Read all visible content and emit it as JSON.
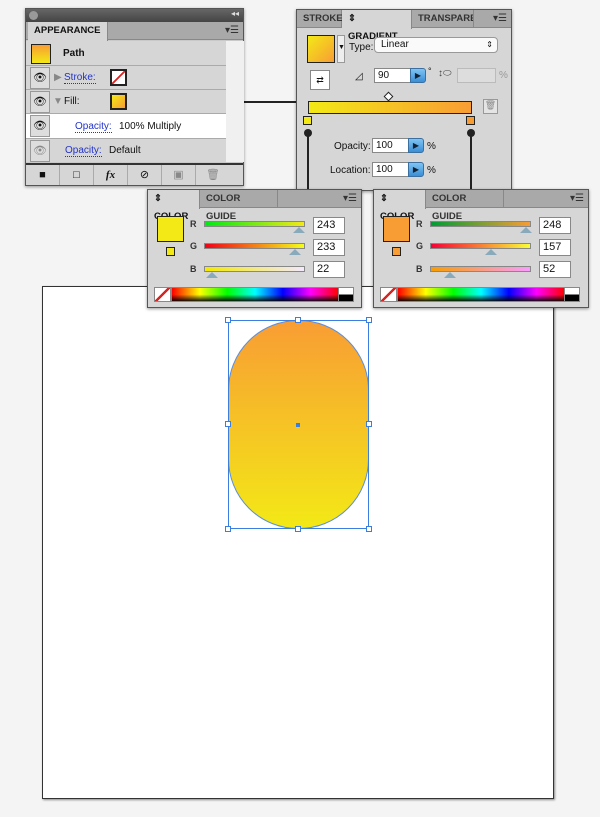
{
  "appearance": {
    "tab": "APPEARANCE",
    "object": "Path",
    "stroke_label": "Stroke:",
    "fill_label": "Fill:",
    "fill_opacity_label": "Opacity:",
    "fill_opacity_value": "100% Multiply",
    "opacity_label": "Opacity:",
    "opacity_value": "Default",
    "fx_label": "fx"
  },
  "gradient": {
    "tabs": [
      "STROKE",
      "GRADIENT",
      "TRANSPARE"
    ],
    "type_label": "Type:",
    "type_value": "Linear",
    "angle": "90",
    "degree": "°",
    "opacity_label": "Opacity:",
    "opacity_value": "100",
    "location_label": "Location:",
    "location_value": "100",
    "percent": "%",
    "start_color": "#f3e916",
    "end_color": "#f89d34"
  },
  "color_left": {
    "tabs": [
      "COLOR",
      "COLOR GUIDE"
    ],
    "R": "243",
    "G": "233",
    "B": "22",
    "swatch": "#f3e916",
    "labels": [
      "R",
      "G",
      "B"
    ]
  },
  "color_right": {
    "tabs": [
      "COLOR",
      "COLOR GUIDE"
    ],
    "R": "248",
    "G": "157",
    "B": "52",
    "swatch": "#f89d34",
    "labels": [
      "R",
      "G",
      "B"
    ]
  }
}
